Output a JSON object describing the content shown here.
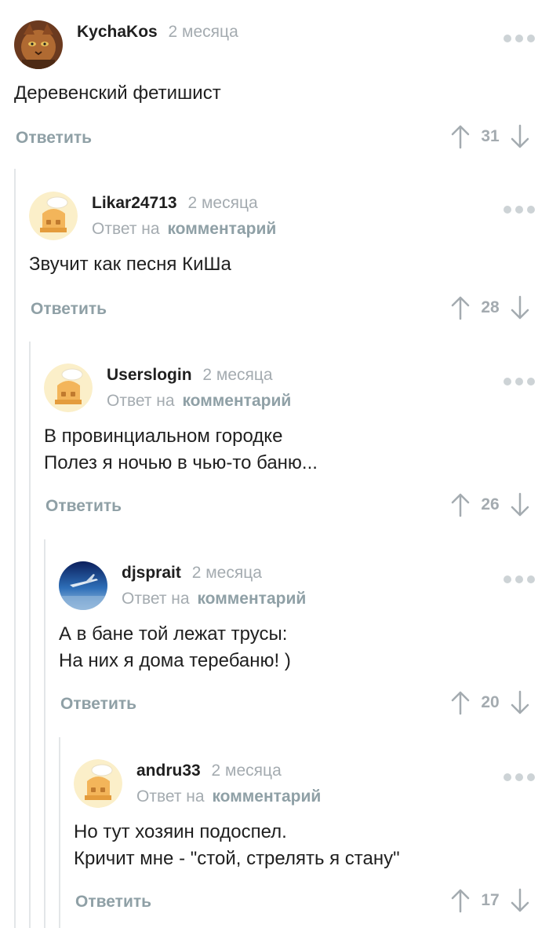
{
  "comments": [
    {
      "author": "KychaKos",
      "time": "2 месяца",
      "reply_to": null,
      "text": "Деревенский фетишист",
      "reply_label": "Ответить",
      "rating": "31",
      "avatar": "cat-photo"
    },
    {
      "author": "Likar24713",
      "time": "2 месяца",
      "reply_prefix": "Ответ на",
      "reply_link": "комментарий",
      "text": "Звучит как песня КиШа",
      "reply_label": "Ответить",
      "rating": "28",
      "avatar": "default-chef"
    },
    {
      "author": "Userslogin",
      "time": "2 месяца",
      "reply_prefix": "Ответ на",
      "reply_link": "комментарий",
      "text": "В провинциальном городке\nПолез я ночью в чью-то баню...",
      "reply_label": "Ответить",
      "rating": "26",
      "avatar": "default-chef"
    },
    {
      "author": "djsprait",
      "time": "2 месяца",
      "reply_prefix": "Ответ на",
      "reply_link": "комментарий",
      "text": "А в бане той лежат трусы:\nНа них я дома теребаню! )",
      "reply_label": "Ответить",
      "rating": "20",
      "avatar": "sky-plane"
    },
    {
      "author": "andru33",
      "time": "2 месяца",
      "reply_prefix": "Ответ на",
      "reply_link": "комментарий",
      "text": "Но тут хозяин подоспел.\nКричит мне - \"стой, стрелять я стану\"",
      "reply_label": "Ответить",
      "rating": "17",
      "avatar": "default-chef"
    }
  ],
  "colors": {
    "meta": "#a4abb0",
    "link": "#8fa0a6",
    "text": "#1f1f1f",
    "thread_line": "#e3e6e8",
    "dots": "#cdd3d6"
  }
}
